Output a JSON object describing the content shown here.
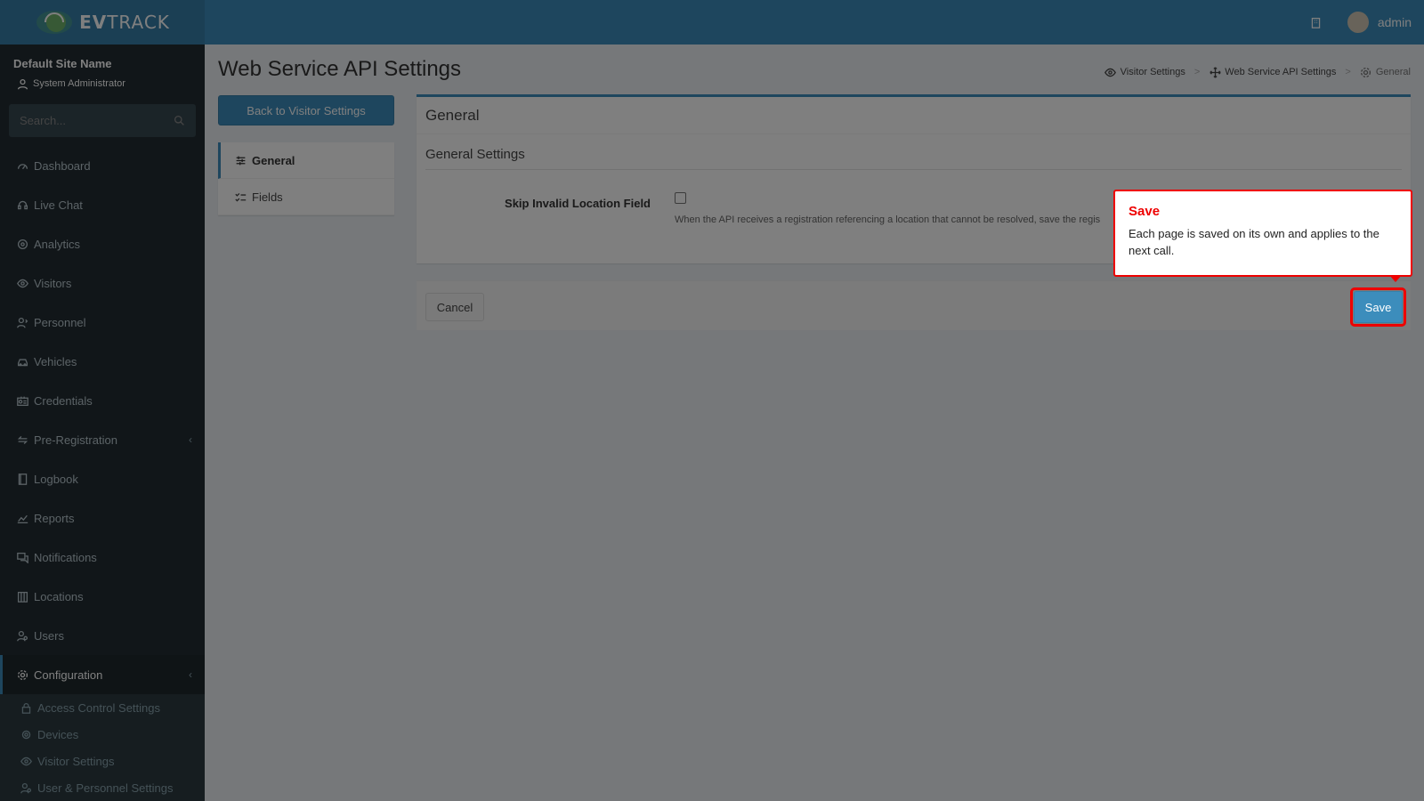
{
  "app": {
    "logo_prefix": "EV",
    "logo_suffix": "TRACK"
  },
  "header": {
    "username": "admin"
  },
  "sidebar": {
    "site_name": "Default Site Name",
    "role": "System Administrator",
    "search_placeholder": "Search...",
    "items": [
      {
        "label": "Dashboard",
        "icon": "dashboard-icon"
      },
      {
        "label": "Live Chat",
        "icon": "headset-icon"
      },
      {
        "label": "Analytics",
        "icon": "analytics-icon"
      },
      {
        "label": "Visitors",
        "icon": "eye-icon"
      },
      {
        "label": "Personnel",
        "icon": "personnel-icon"
      },
      {
        "label": "Vehicles",
        "icon": "car-icon"
      },
      {
        "label": "Credentials",
        "icon": "id-card-icon"
      },
      {
        "label": "Pre-Registration",
        "icon": "exchange-icon"
      },
      {
        "label": "Logbook",
        "icon": "book-icon"
      },
      {
        "label": "Reports",
        "icon": "chart-icon"
      },
      {
        "label": "Notifications",
        "icon": "comments-icon"
      },
      {
        "label": "Locations",
        "icon": "building-icon"
      },
      {
        "label": "Users",
        "icon": "users-icon"
      },
      {
        "label": "Configuration",
        "icon": "gear-icon"
      }
    ],
    "sub_items": [
      {
        "label": "Access Control Settings",
        "icon": "lock-icon"
      },
      {
        "label": "Devices",
        "icon": "device-icon"
      },
      {
        "label": "Visitor Settings",
        "icon": "eye-icon"
      },
      {
        "label": "User & Personnel Settings",
        "icon": "users-icon"
      }
    ]
  },
  "page": {
    "title": "Web Service API Settings",
    "breadcrumb": [
      "Visitor Settings",
      "Web Service API Settings",
      "General"
    ],
    "back_button": "Back to Visitor Settings",
    "tabs": [
      "General",
      "Fields"
    ]
  },
  "panel": {
    "title": "General",
    "section_title": "General Settings",
    "field_label": "Skip Invalid Location Field",
    "field_checked": false,
    "help_text": "When the API receives a registration referencing a location that cannot be resolved, save the regis"
  },
  "footer": {
    "cancel_label": "Cancel",
    "save_label": "Save"
  },
  "tooltip": {
    "title": "Save",
    "body": "Each page is saved on its own and applies to the next call."
  },
  "colors": {
    "brand": "#3c8dbc",
    "sidebar_bg": "#222d32",
    "highlight": "#ee0000"
  }
}
